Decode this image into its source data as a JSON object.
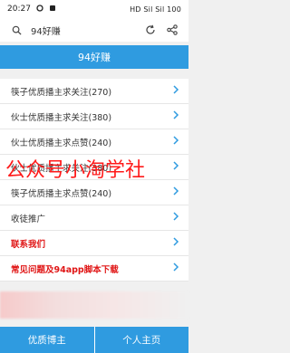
{
  "status_bar": {
    "time": "20:27",
    "right": "HD Sil Sil 100"
  },
  "search": {
    "query": "94好赚"
  },
  "title": "94好赚",
  "menu": [
    {
      "label": "筷子优质播主求关注(270)",
      "color": "#333333"
    },
    {
      "label": "伙士优质播主求关注(380)",
      "color": "#333333"
    },
    {
      "label": "伙士优质播主求点赞(240)",
      "color": "#333333"
    },
    {
      "label": "伙士优质播主求关注(380)",
      "color": "#333333"
    },
    {
      "label": "筷子优质播主求点赞(240)",
      "color": "#333333"
    },
    {
      "label": "收徒推广",
      "color": "#333333"
    },
    {
      "label": "联系我们",
      "color": "#e01515"
    },
    {
      "label": "常见问题及94app脚本下载",
      "color": "#e01515"
    }
  ],
  "watermark": "公众号小淘学社",
  "tabs": [
    {
      "label": "优质博主"
    },
    {
      "label": "个人主页"
    }
  ],
  "colors": {
    "accent": "#2f9be0",
    "red": "#e01515",
    "background": "#f0f0f0"
  }
}
